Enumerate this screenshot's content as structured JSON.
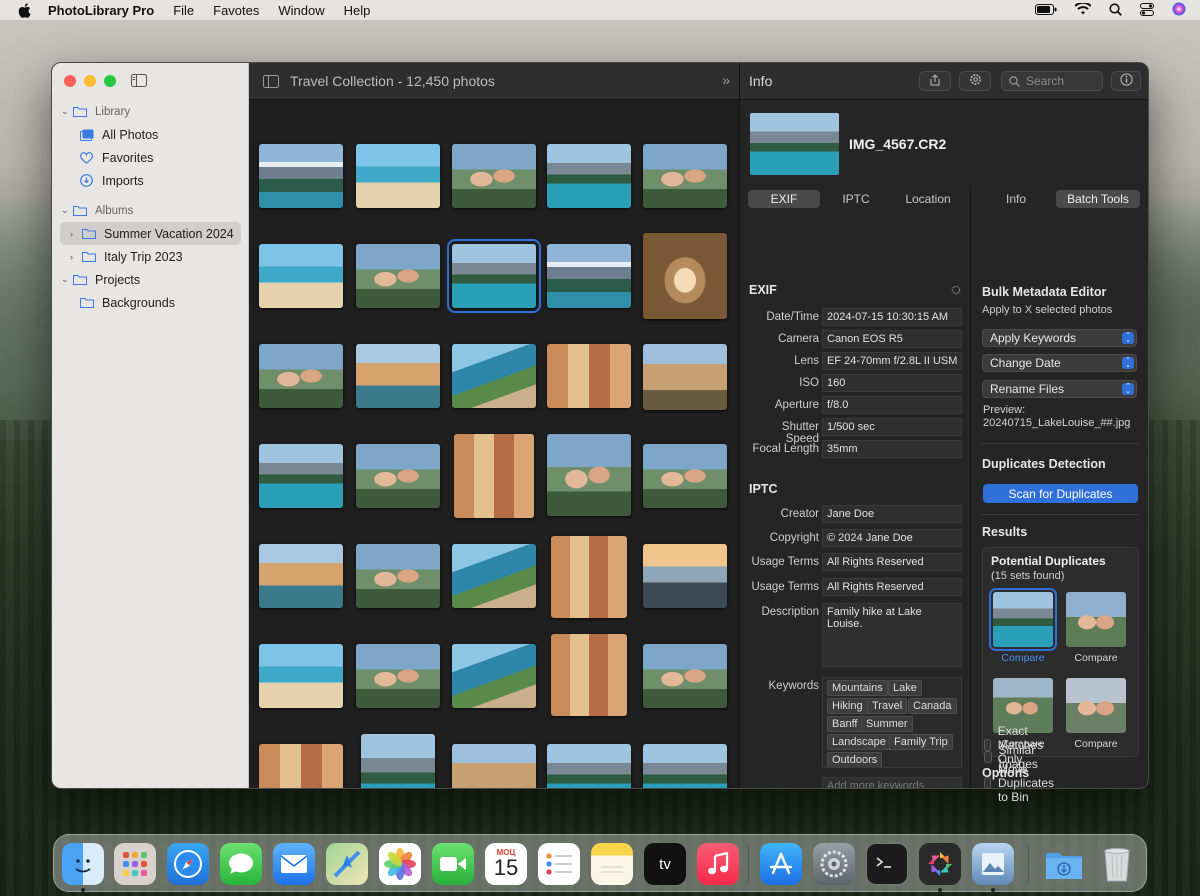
{
  "menubar": {
    "app_name": "PhotoLibrary Pro",
    "menus": [
      "File",
      "Favotes",
      "Window",
      "Help"
    ]
  },
  "sidebar": {
    "sections": [
      {
        "label": "Library",
        "items": [
          "All Photos",
          "Favorites",
          "Imports"
        ]
      },
      {
        "label": "Albums",
        "items": [
          "Summer Vacation 2024",
          "Italy Trip 2023"
        ]
      },
      {
        "label": "Projects",
        "items": [
          "Backgrounds"
        ]
      }
    ]
  },
  "content": {
    "title": "Travel Collection - 12,450 photos"
  },
  "info": {
    "title": "Info",
    "search_placeholder": "Search",
    "filename": "IMG_4567.CR2",
    "tabs_left": [
      "EXIF",
      "IPTC",
      "Location"
    ],
    "tabs_right": [
      "Info",
      "Batch Tools"
    ],
    "exif_heading": "EXIF",
    "exif": [
      {
        "label": "Date/Time",
        "value": "2024-07-15 10:30:15 AM"
      },
      {
        "label": "Camera",
        "value": "Canon EOS R5"
      },
      {
        "label": "Lens",
        "value": "EF 24-70mm f/2.8L II USM"
      },
      {
        "label": "ISO",
        "value": "160"
      },
      {
        "label": "Aperture",
        "value": "f/8.0"
      },
      {
        "label": "Shutter Speed",
        "value": "1/500 sec"
      },
      {
        "label": "Focal Length",
        "value": "35mm"
      }
    ],
    "iptc_heading": "IPTC",
    "iptc": [
      {
        "label": "Creator",
        "value": "Jane Doe"
      },
      {
        "label": "Copyright",
        "value": "© 2024 Jane Doe"
      },
      {
        "label": "Usage Terms",
        "value": "All Rights Reserved"
      },
      {
        "label": "Usage Terms",
        "value": "All Rights Reserved"
      }
    ],
    "description_label": "Description",
    "description": "Family hike at Lake Louise.",
    "keywords_label": "Keywords",
    "keywords": [
      "Mountains",
      "Lake",
      "Hiking",
      "Travel",
      "Canada",
      "Banff",
      "Summer",
      "Landscape",
      "Family Trip",
      "Outdoors"
    ],
    "keywords_placeholder": "Add more keywords"
  },
  "batch": {
    "heading": "Bulk Metadata Editor",
    "subtitle": "Apply to X selected photos",
    "popups": [
      "Apply Keywords",
      "Change Date",
      "Rename Files"
    ],
    "preview_label": "Preview:",
    "preview_value": "20240715_LakeLouise_##.jpg",
    "dup_heading": "Duplicates Detection",
    "scan_button": "Scan for Duplicates",
    "results_heading": "Results",
    "potential_title": "Potential Duplicates",
    "potential_sub": "(15 sets found)",
    "compare_label": "Compare",
    "options_heading": "Options",
    "options": [
      "Exact Matches Only",
      "Similar Images",
      "Move Duplicates to Bin"
    ]
  },
  "dock": {
    "calendar_month": "МОЦ",
    "calendar_day": "15",
    "tv_label": "tv"
  },
  "colors": {
    "accent": "#2e6fd8",
    "window_bg": "#1f1f1f",
    "sidebar_bg": "#e8e6e4"
  }
}
